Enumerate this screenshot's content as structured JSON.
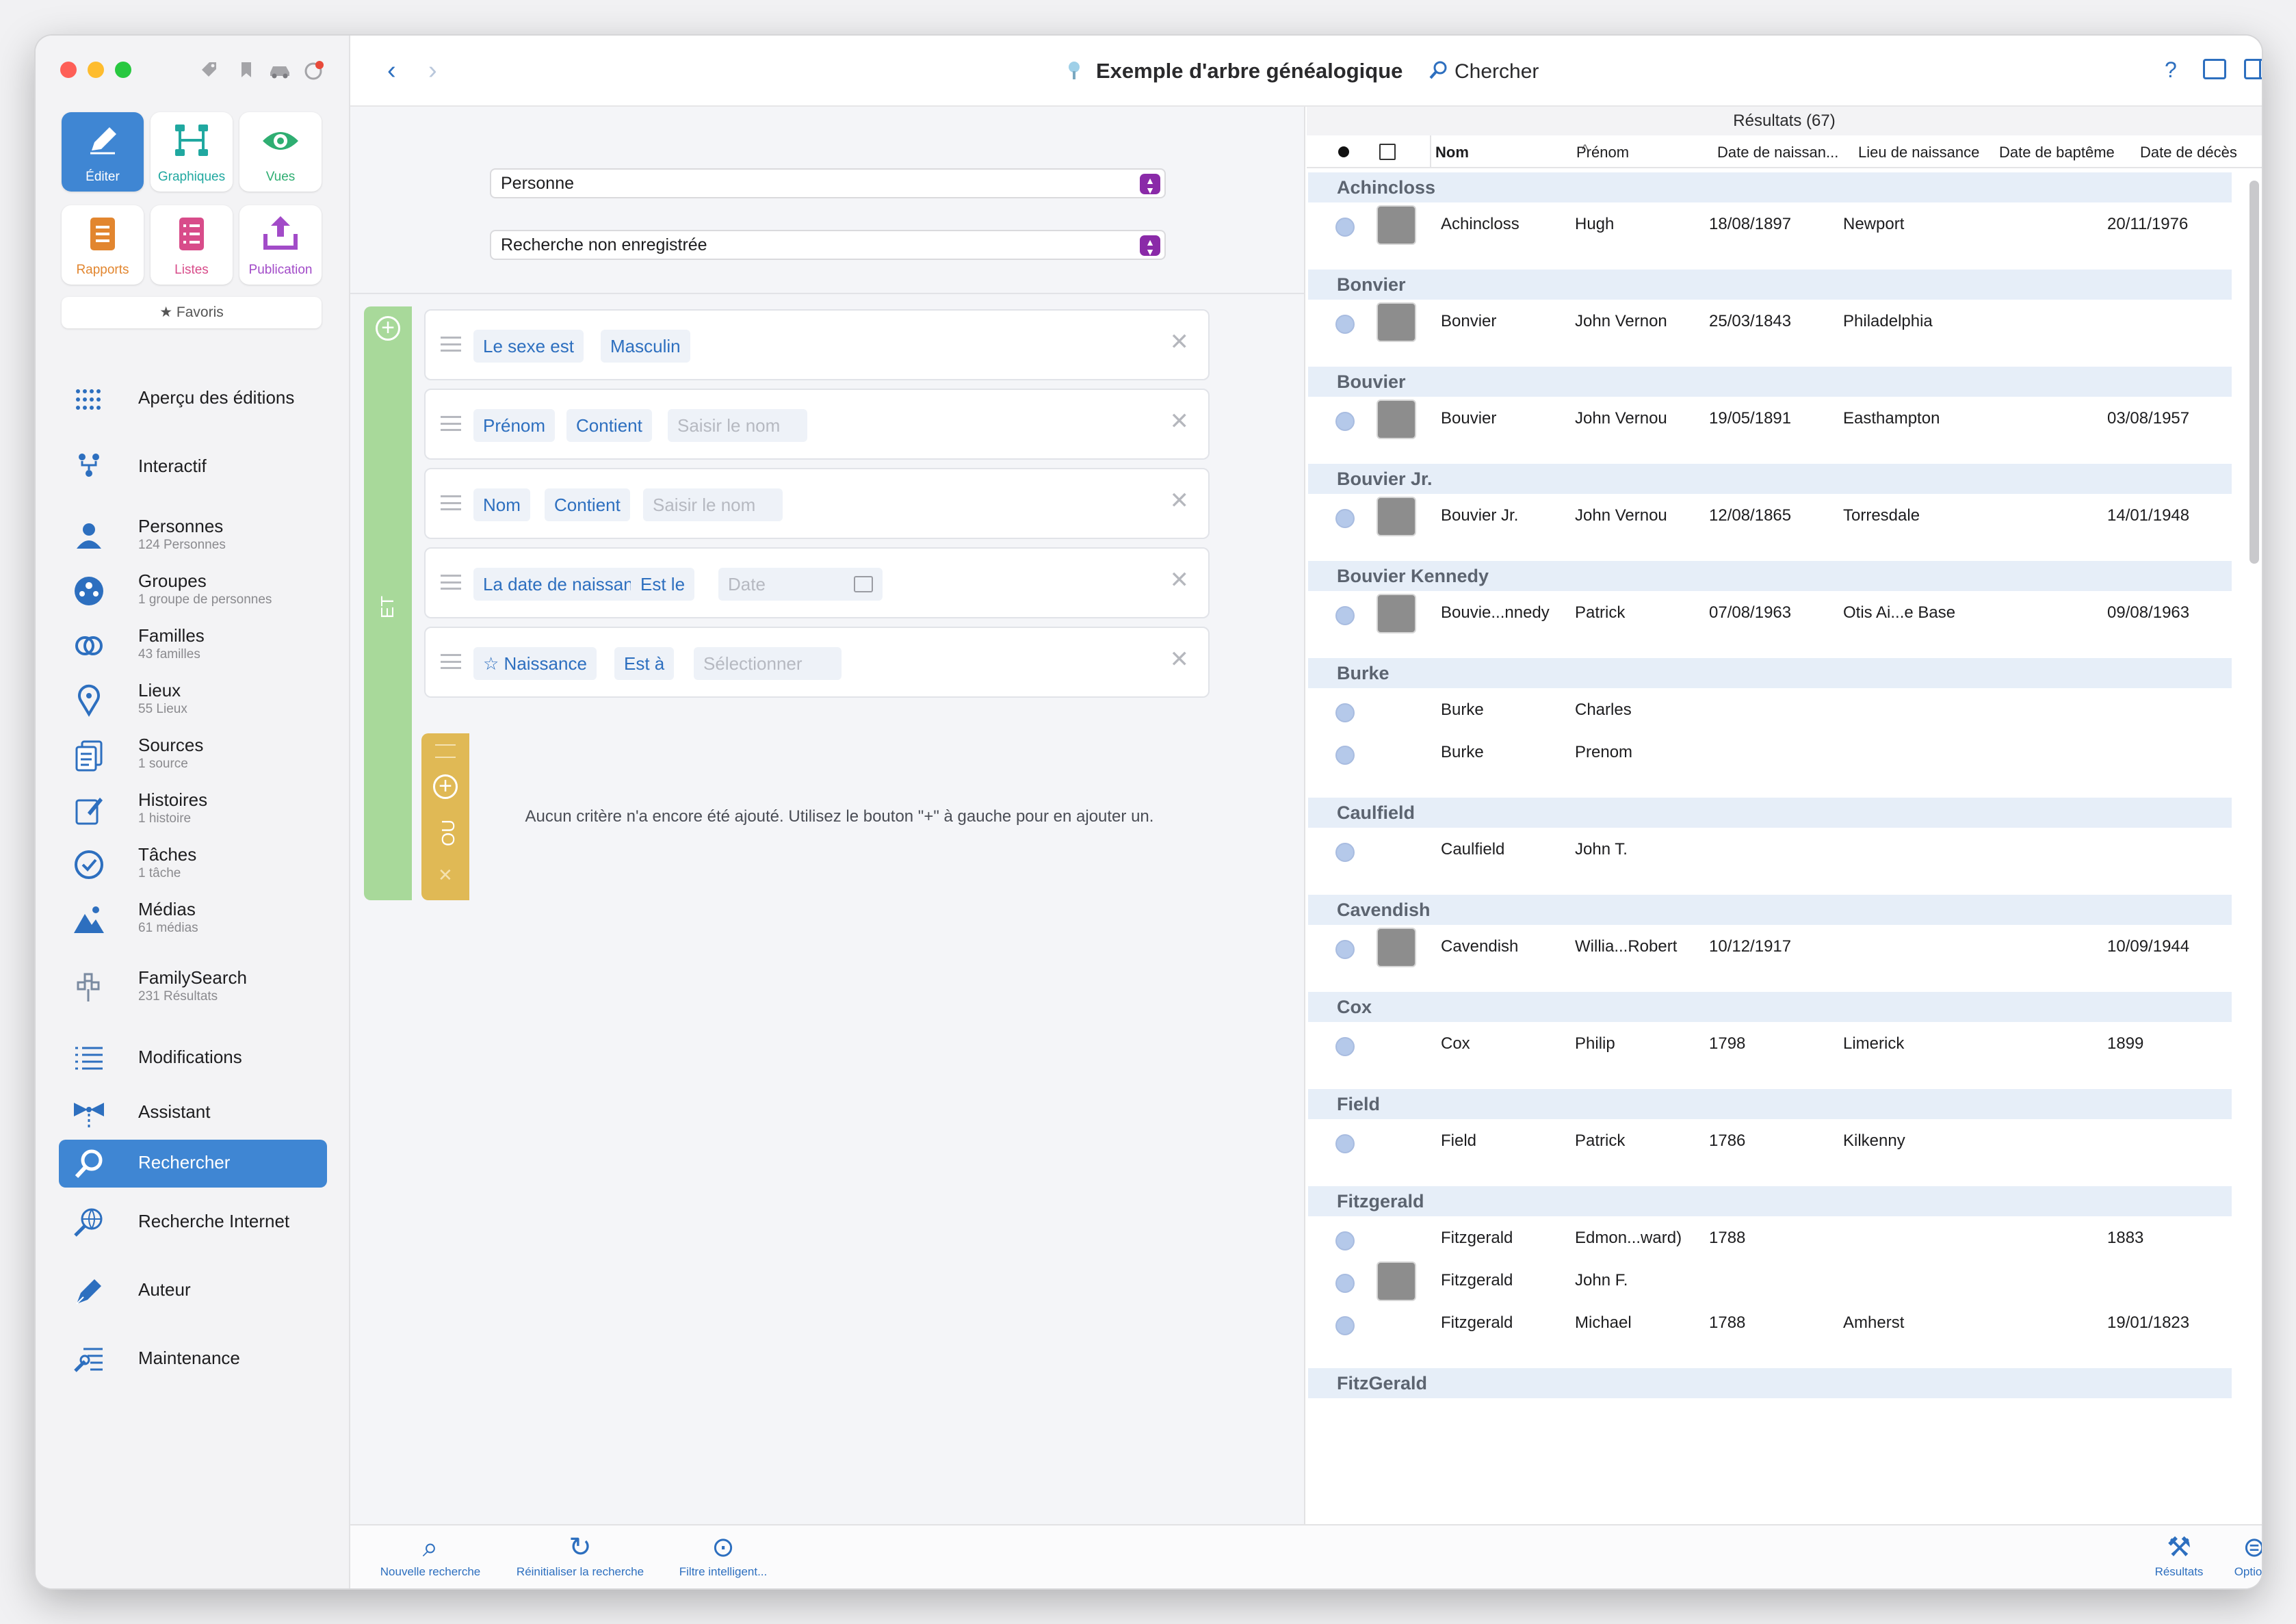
{
  "toolbar": {
    "title": "Exemple d'arbre généalogique",
    "search_label": "Chercher"
  },
  "tiles": [
    {
      "label": "Éditer"
    },
    {
      "label": "Graphiques"
    },
    {
      "label": "Vues"
    },
    {
      "label": "Rapports"
    },
    {
      "label": "Listes"
    },
    {
      "label": "Publication"
    }
  ],
  "favorites": "★ Favoris",
  "nav": [
    {
      "title": "Aperçu des éditions",
      "sub": ""
    },
    {
      "title": "Interactif",
      "sub": ""
    },
    {
      "title": "Personnes",
      "sub": "124 Personnes"
    },
    {
      "title": "Groupes",
      "sub": "1 groupe de personnes"
    },
    {
      "title": "Familles",
      "sub": "43 familles"
    },
    {
      "title": "Lieux",
      "sub": "55 Lieux"
    },
    {
      "title": "Sources",
      "sub": "1 source"
    },
    {
      "title": "Histoires",
      "sub": "1 histoire"
    },
    {
      "title": "Tâches",
      "sub": "1 tâche"
    },
    {
      "title": "Médias",
      "sub": "61 médias"
    },
    {
      "title": "FamilySearch",
      "sub": "231 Résultats"
    },
    {
      "title": "Modifications",
      "sub": ""
    },
    {
      "title": "Assistant",
      "sub": ""
    },
    {
      "title": "Rechercher",
      "sub": ""
    },
    {
      "title": "Recherche Internet",
      "sub": ""
    },
    {
      "title": "Auteur",
      "sub": ""
    },
    {
      "title": "Maintenance",
      "sub": ""
    }
  ],
  "search": {
    "entity_select": "Personne",
    "saved_select": "Recherche non enregistrée",
    "and_label": "ET",
    "or_label": "OU",
    "criteria": [
      {
        "field": "Le sexe est",
        "op": "Masculin",
        "value": ""
      },
      {
        "field": "Prénom",
        "op": "Contient",
        "value": "Saisir le nom"
      },
      {
        "field": "Nom",
        "op": "Contient",
        "value": "Saisir le nom"
      },
      {
        "field": "La date de naissance",
        "op": "Est le",
        "value": "Date"
      },
      {
        "field": "Naissance",
        "op": "Est à",
        "value": "Sélectionner"
      }
    ],
    "empty_hint": "Aucun critère n'a encore été ajouté. Utilisez le bouton \"+\" à gauche pour en ajouter un."
  },
  "results": {
    "title": "Résultats (67)",
    "columns": [
      "Nom",
      "Prénom",
      "Date de naissan...",
      "Lieu de naissance",
      "Date de baptême",
      "Date de décès"
    ],
    "groups": [
      {
        "name": "Achincloss",
        "rows": [
          {
            "nom": "Achincloss",
            "prenom": "Hugh",
            "naiss": "18/08/1897",
            "lieu": "Newport",
            "deces": "20/11/1976",
            "photo": true
          }
        ]
      },
      {
        "name": "Bonvier",
        "rows": [
          {
            "nom": "Bonvier",
            "prenom": "John Vernon",
            "naiss": "25/03/1843",
            "lieu": "Philadelphia",
            "deces": "",
            "photo": true
          }
        ]
      },
      {
        "name": "Bouvier",
        "rows": [
          {
            "nom": "Bouvier",
            "prenom": "John Vernou",
            "naiss": "19/05/1891",
            "lieu": "Easthampton",
            "deces": "03/08/1957",
            "photo": true
          }
        ]
      },
      {
        "name": "Bouvier Jr.",
        "rows": [
          {
            "nom": "Bouvier Jr.",
            "prenom": "John Vernou",
            "naiss": "12/08/1865",
            "lieu": "Torresdale",
            "deces": "14/01/1948",
            "photo": true
          }
        ]
      },
      {
        "name": "Bouvier Kennedy",
        "rows": [
          {
            "nom": "Bouvie...nnedy",
            "prenom": "Patrick",
            "naiss": "07/08/1963",
            "lieu": "Otis Ai...e Base",
            "deces": "09/08/1963",
            "photo": true
          }
        ]
      },
      {
        "name": "Burke",
        "rows": [
          {
            "nom": "Burke",
            "prenom": "Charles",
            "naiss": "",
            "lieu": "",
            "deces": "",
            "photo": false
          },
          {
            "nom": "Burke",
            "prenom": "Prenom",
            "naiss": "",
            "lieu": "",
            "deces": "",
            "photo": false
          }
        ]
      },
      {
        "name": "Caulfield",
        "rows": [
          {
            "nom": "Caulfield",
            "prenom": "John T.",
            "naiss": "",
            "lieu": "",
            "deces": "",
            "photo": false
          }
        ]
      },
      {
        "name": "Cavendish",
        "rows": [
          {
            "nom": "Cavendish",
            "prenom": "Willia...Robert",
            "naiss": "10/12/1917",
            "lieu": "",
            "deces": "10/09/1944",
            "photo": true
          }
        ]
      },
      {
        "name": "Cox",
        "rows": [
          {
            "nom": "Cox",
            "prenom": "Philip",
            "naiss": "1798",
            "lieu": "Limerick",
            "deces": "1899",
            "photo": false
          }
        ]
      },
      {
        "name": "Field",
        "rows": [
          {
            "nom": "Field",
            "prenom": "Patrick",
            "naiss": "1786",
            "lieu": "Kilkenny",
            "deces": "",
            "photo": false
          }
        ]
      },
      {
        "name": "Fitzgerald",
        "rows": [
          {
            "nom": "Fitzgerald",
            "prenom": "Edmon...ward)",
            "naiss": "1788",
            "lieu": "",
            "deces": "1883",
            "photo": false
          },
          {
            "nom": "Fitzgerald",
            "prenom": "John F.",
            "naiss": "",
            "lieu": "",
            "deces": "",
            "photo": true
          },
          {
            "nom": "Fitzgerald",
            "prenom": "Michael",
            "naiss": "1788",
            "lieu": "Amherst",
            "deces": "19/01/1823",
            "photo": false
          }
        ]
      },
      {
        "name": "FitzGerald",
        "rows": []
      }
    ]
  },
  "bottom": {
    "new_search": "Nouvelle recherche",
    "reset": "Réinitialiser la recherche",
    "smart_filter": "Filtre intelligent...",
    "results": "Résultats",
    "options": "Options"
  },
  "colors": {
    "accent": "#3f86d3",
    "and_bar": "#a8d99a",
    "or_bar": "#e0b955"
  }
}
